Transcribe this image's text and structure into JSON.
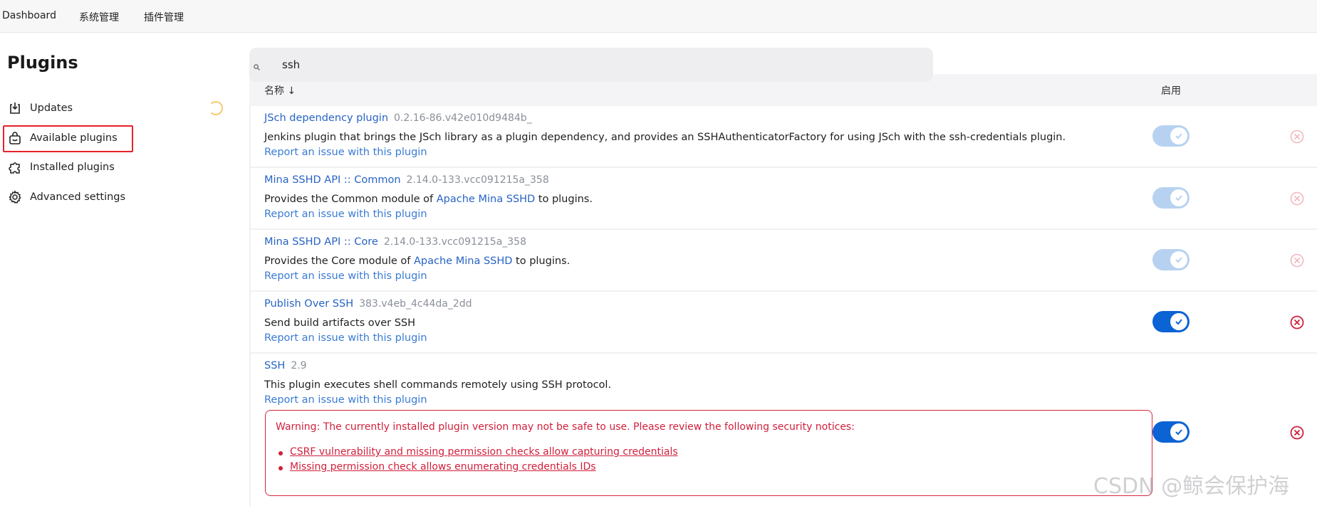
{
  "breadcrumb": [
    "Dashboard",
    "系统管理",
    "插件管理"
  ],
  "sidebar": {
    "title": "Plugins",
    "items": [
      {
        "label": "Updates",
        "icon": "download-icon"
      },
      {
        "label": "Available plugins",
        "icon": "shopping-bag-icon"
      },
      {
        "label": "Installed plugins",
        "icon": "puzzle-icon"
      },
      {
        "label": "Advanced settings",
        "icon": "gear-icon"
      }
    ],
    "selected_index": 1
  },
  "search": {
    "value": "ssh",
    "icon": "search-icon"
  },
  "table": {
    "col_name": "名称 ↓",
    "col_enabled": "启用",
    "report_label": "Report an issue with this plugin",
    "rows": [
      {
        "name": "JSch dependency plugin",
        "version": "0.2.16-86.v42e010d9484b_",
        "desc_before": "Jenkins plugin that brings the JSch library as a plugin dependency, and provides an SSHAuthenticatorFactory for using JSch with the ssh-credentials plugin.",
        "desc_link": "",
        "desc_after": "",
        "enabled": true,
        "locked": true
      },
      {
        "name": "Mina SSHD API :: Common",
        "version": "2.14.0-133.vcc091215a_358",
        "desc_before": "Provides the Common module of ",
        "desc_link": "Apache Mina SSHD",
        "desc_after": " to plugins.",
        "enabled": true,
        "locked": true
      },
      {
        "name": "Mina SSHD API :: Core",
        "version": "2.14.0-133.vcc091215a_358",
        "desc_before": "Provides the Core module of ",
        "desc_link": "Apache Mina SSHD",
        "desc_after": " to plugins.",
        "enabled": true,
        "locked": true
      },
      {
        "name": "Publish Over SSH",
        "version": "383.v4eb_4c44da_2dd",
        "desc_before": "Send build artifacts over SSH",
        "desc_link": "",
        "desc_after": "",
        "enabled": true,
        "locked": false
      },
      {
        "name": "SSH",
        "version": "2.9",
        "desc_before": "This plugin executes shell commands remotely using SSH protocol.",
        "desc_link": "",
        "desc_after": "",
        "enabled": true,
        "locked": false
      }
    ]
  },
  "warning": {
    "text": "Warning: The currently installed plugin version may not be safe to use. Please review the following security notices:",
    "links": [
      "CSRF vulnerability and missing permission checks allow capturing credentials",
      "Missing permission check allows enumerating credentials IDs"
    ]
  },
  "watermark": "CSDN @鲸会保护海",
  "colors": {
    "accent": "#0b63d4",
    "danger": "#d01f3b",
    "link": "#2763c4",
    "highlight_box": "#e62129"
  }
}
